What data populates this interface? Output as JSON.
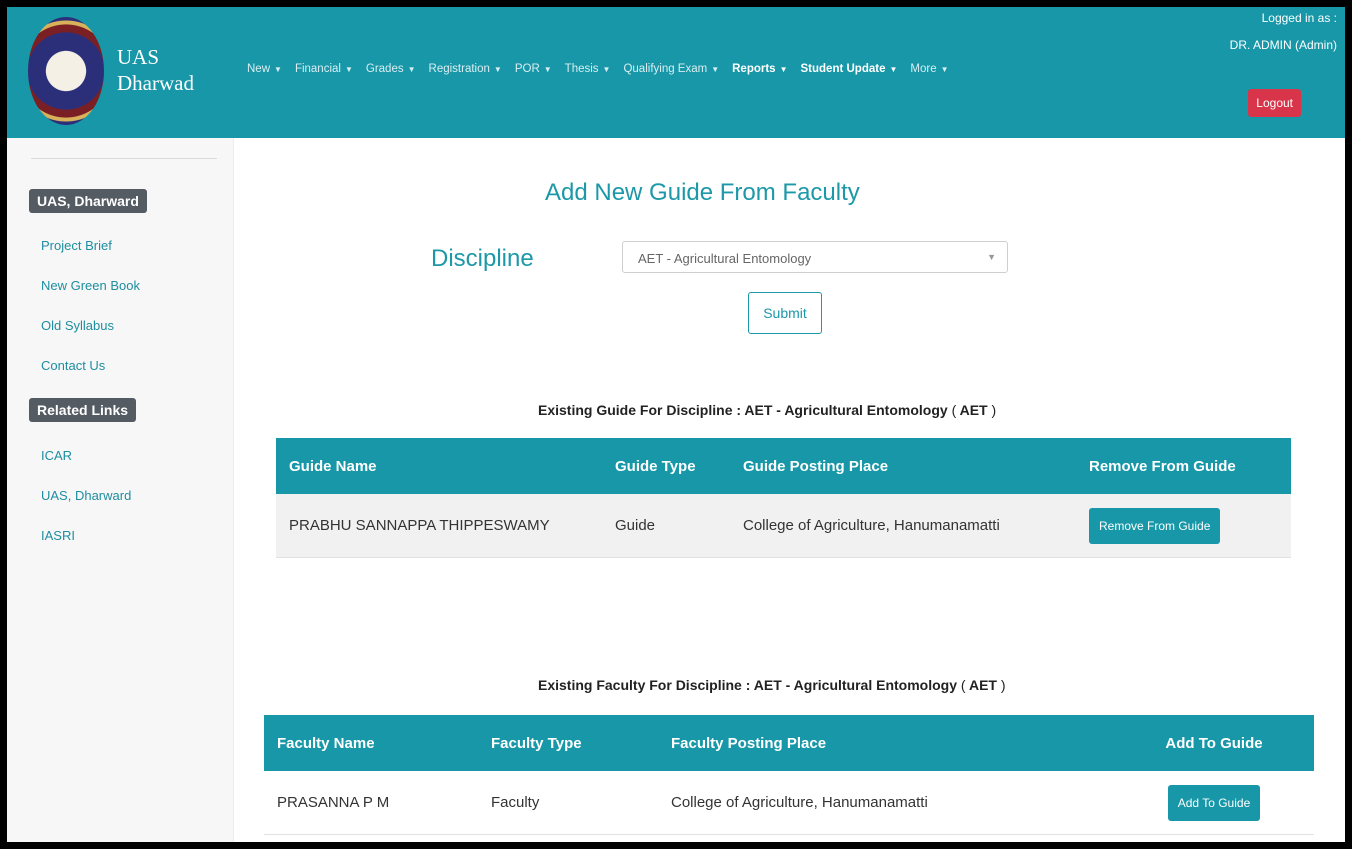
{
  "header": {
    "brand_line1": "UAS",
    "brand_line2": "Dharwad",
    "nav": [
      "New",
      "Financial",
      "Grades",
      "Registration",
      "POR",
      "Thesis",
      "Qualifying Exam",
      "Reports",
      "Student Update",
      "More"
    ],
    "active_nav": "Reports",
    "logged_in_label": "Logged in as :",
    "logged_in_user": "DR. ADMIN (Admin)",
    "logout_label": "Logout"
  },
  "sidebar": {
    "section1_title": "UAS, Dharward",
    "section1_links": [
      "Project Brief",
      "New Green Book",
      "Old Syllabus",
      "Contact Us"
    ],
    "section2_title": "Related Links",
    "section2_links": [
      "ICAR",
      "UAS, Dharward",
      "IASRI"
    ]
  },
  "main": {
    "page_title": "Add New Guide From Faculty",
    "discipline_label": "Discipline",
    "discipline_value": "AET - Agricultural Entomology",
    "submit_label": "Submit",
    "guide_section": {
      "title_prefix": "Existing Guide For Discipline : AET - Agricultural Entomology",
      "code": "AET",
      "columns": [
        "Guide Name",
        "Guide Type",
        "Guide Posting Place",
        "Remove From Guide"
      ],
      "rows": [
        {
          "name": "PRABHU SANNAPPA THIPPESWAMY",
          "type": "Guide",
          "place": "College of Agriculture, Hanumanamatti",
          "action": "Remove From Guide"
        }
      ]
    },
    "faculty_section": {
      "title_prefix": "Existing Faculty For Discipline : AET - Agricultural Entomology",
      "code": "AET",
      "columns": [
        "Faculty Name",
        "Faculty Type",
        "Faculty Posting Place",
        "Add To Guide"
      ],
      "rows": [
        {
          "name": "PRASANNA P M",
          "type": "Faculty",
          "place": "College of Agriculture, Hanumanamatti",
          "action": "Add To Guide"
        }
      ]
    }
  }
}
